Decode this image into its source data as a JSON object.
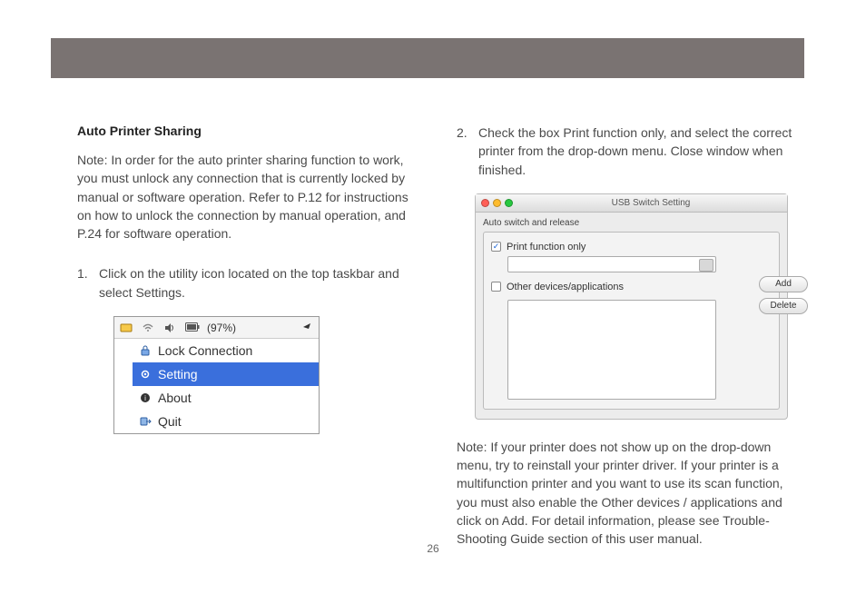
{
  "header": {},
  "left": {
    "title": "Auto Printer Sharing",
    "note": "Note: In order for the auto printer sharing function to work, you must unlock any connection that is currently locked by manual or software operation.  Refer to P.12 for instructions on how to unlock the connection by manual operation, and P.24 for software operation.",
    "step1_num": "1.",
    "step1_text": "Click on the utility icon located on the top taskbar and select Settings.",
    "menubar": {
      "battery": "(97%)",
      "items": [
        {
          "label": "Lock Connection",
          "selected": false
        },
        {
          "label": "Setting",
          "selected": true
        },
        {
          "label": "About",
          "selected": false
        },
        {
          "label": "Quit",
          "selected": false
        }
      ]
    }
  },
  "right": {
    "step2_num": "2.",
    "step2_text": "Check the box Print function only, and select the correct printer from the drop-down menu. Close window when finished.",
    "window": {
      "title": "USB Switch Setting",
      "group_label": "Auto switch and release",
      "print_only_label": "Print function only",
      "print_only_checked": true,
      "other_devices_label": "Other devices/applications",
      "other_devices_checked": false,
      "add_label": "Add",
      "delete_label": "Delete"
    },
    "note2": "Note: If your printer does not show up on the drop-down menu, try to reinstall your printer driver.  If your printer is a multifunction printer and you want to use its scan function, you must also enable the Other devices / applications and click on Add.  For detail information, please see Trouble-Shooting Guide section of this user manual."
  },
  "page_number": "26"
}
